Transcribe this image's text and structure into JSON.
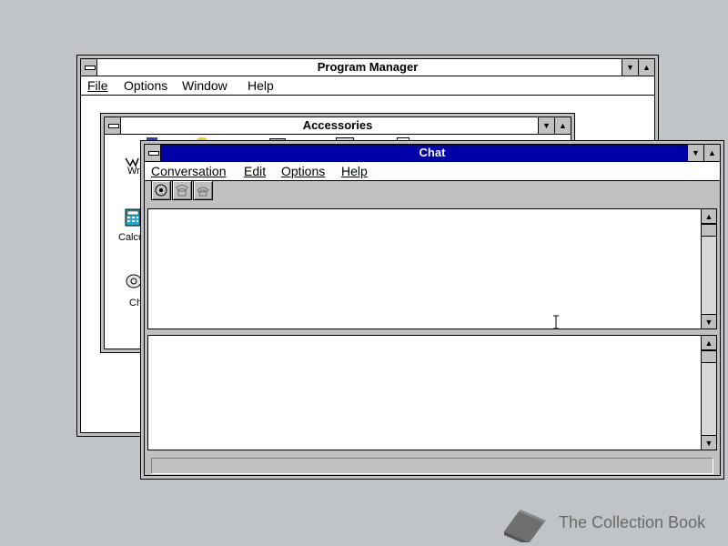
{
  "desktop": {
    "background": "#c0c4c8"
  },
  "program_manager": {
    "title": "Program Manager",
    "menu": [
      "File",
      "Options",
      "Window",
      "Help"
    ]
  },
  "accessories": {
    "title": "Accessories",
    "icons": [
      {
        "label": "Wri",
        "icon": "write-icon"
      },
      {
        "label": "Calcu",
        "icon": "calculator-icon"
      },
      {
        "label": "Ch",
        "icon": "chat-phone-icon"
      }
    ]
  },
  "chat": {
    "title": "Chat",
    "title_color": "#0000a8",
    "menu": [
      "Conversation",
      "Edit",
      "Options",
      "Help"
    ],
    "toolbar": [
      "dial-icon",
      "answer-icon",
      "hang-up-icon"
    ]
  },
  "watermark": {
    "text": "The Collection Book"
  }
}
